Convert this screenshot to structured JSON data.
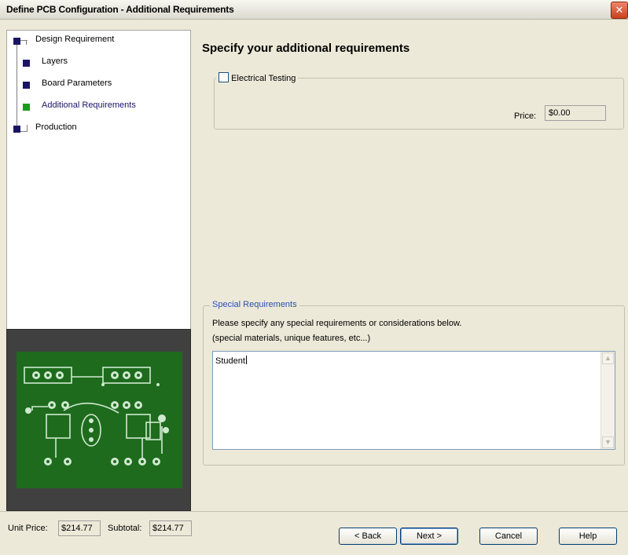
{
  "window": {
    "title": "Define PCB Configuration - Additional Requirements"
  },
  "nav": {
    "items": [
      {
        "label": "Design Requirement",
        "active": false
      },
      {
        "label": "Layers",
        "active": false
      },
      {
        "label": "Board Parameters",
        "active": false
      },
      {
        "label": "Additional Requirements",
        "active": true
      },
      {
        "label": "Production",
        "active": false
      }
    ]
  },
  "main": {
    "heading": "Specify your additional requirements",
    "electrical_testing": {
      "label": "Electrical Testing",
      "checked": false,
      "price_label": "Price:",
      "price_value": "$0.00"
    },
    "special": {
      "legend": "Special Requirements",
      "instructions_line1": "Please specify any special requirements or considerations below.",
      "instructions_line2": "(special materials, unique features, etc...)",
      "value": "Student"
    }
  },
  "status": {
    "unit_price_label": "Unit Price:",
    "unit_price_value": "$214.77",
    "subtotal_label": "Subtotal:",
    "subtotal_value": "$214.77"
  },
  "buttons": {
    "back": "< Back",
    "next": "Next >",
    "cancel": "Cancel",
    "help": "Help"
  },
  "colors": {
    "nav_node": "#1b1464",
    "nav_node_active": "#1d9a1d",
    "pcb_green": "#1e6b1e",
    "legend_blue": "#2a4fb8"
  }
}
